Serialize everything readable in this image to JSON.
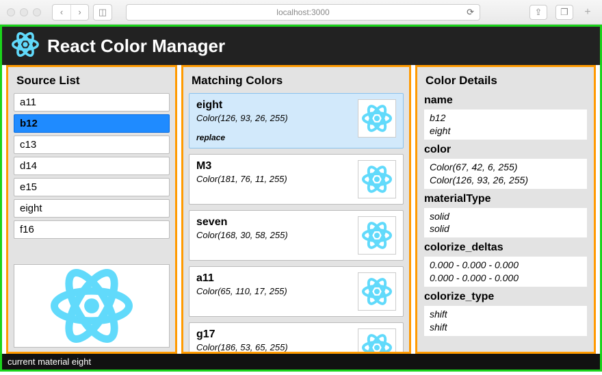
{
  "browser": {
    "url": "localhost:3000",
    "back": "‹",
    "fwd": "›",
    "reload": "⟳",
    "share": "⇪",
    "tabs_icon": "❐",
    "add": "+"
  },
  "header": {
    "title": "React Color Manager",
    "logo": "react-logo"
  },
  "source_list": {
    "title": "Source List",
    "selected": "b12",
    "items": [
      "a11",
      "b12",
      "c13",
      "d14",
      "e15",
      "eight",
      "f16"
    ]
  },
  "matching": {
    "title": "Matching Colors",
    "selected_index": 0,
    "items": [
      {
        "name": "eight",
        "color": "Color(126, 93, 26, 255)",
        "action": "replace"
      },
      {
        "name": "M3",
        "color": "Color(181, 76, 11, 255)"
      },
      {
        "name": "seven",
        "color": "Color(168, 30, 58, 255)"
      },
      {
        "name": "a11",
        "color": "Color(65, 110, 17, 255)"
      },
      {
        "name": "g17",
        "color": "Color(186, 53, 65, 255)"
      }
    ]
  },
  "details": {
    "title": "Color Details",
    "groups": [
      {
        "key": "name",
        "values": [
          "b12",
          "eight"
        ]
      },
      {
        "key": "color",
        "values": [
          "Color(67, 42, 6, 255)",
          "Color(126, 93, 26, 255)"
        ]
      },
      {
        "key": "materialType",
        "values": [
          "solid",
          "solid"
        ]
      },
      {
        "key": "colorize_deltas",
        "values": [
          "0.000 - 0.000 - 0.000",
          "0.000 - 0.000 - 0.000"
        ]
      },
      {
        "key": "colorize_type",
        "values": [
          "shift",
          "shift"
        ]
      }
    ]
  },
  "footer": {
    "text": "current material eight"
  }
}
